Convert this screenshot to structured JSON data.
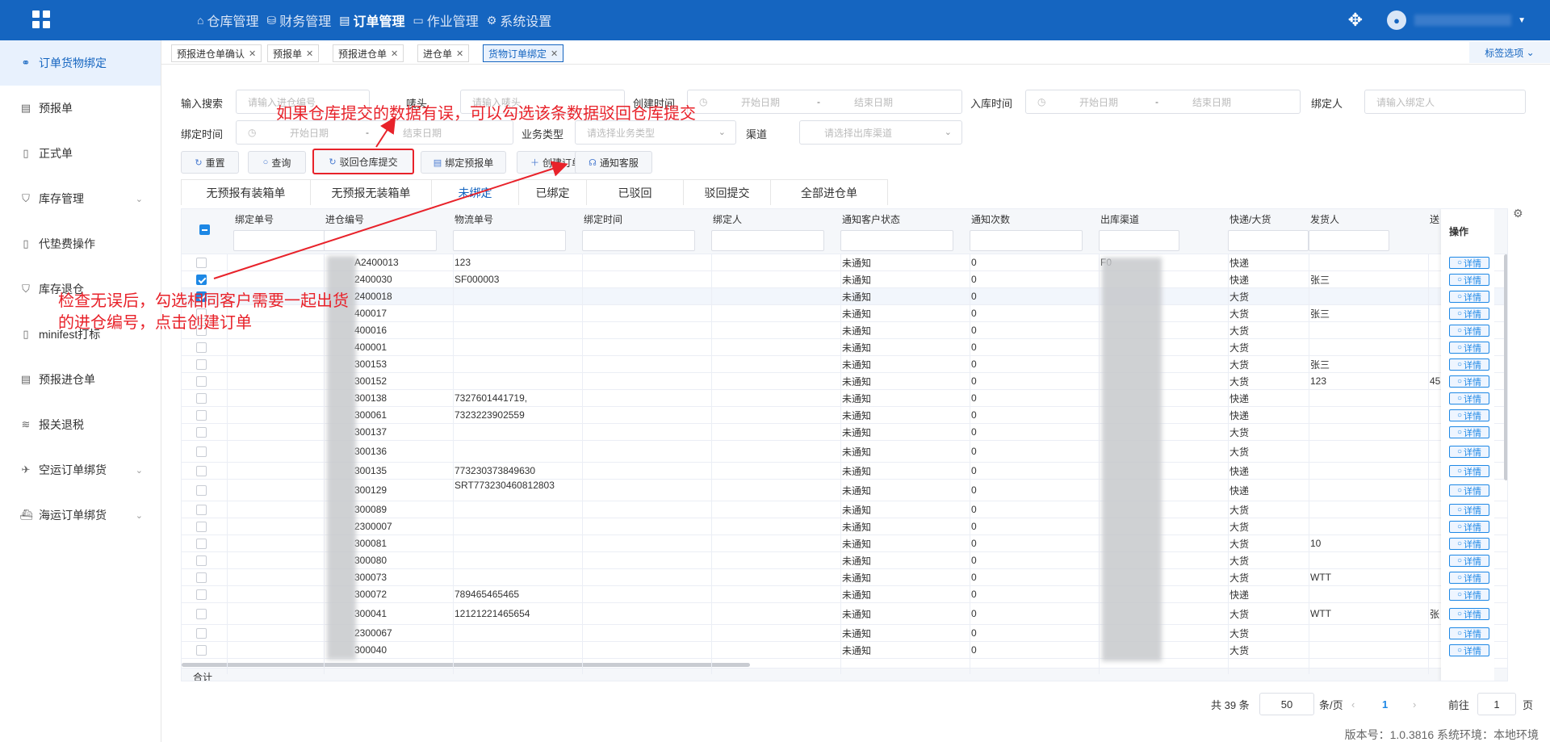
{
  "topbar": {
    "nav": [
      {
        "label": "仓库管理",
        "icon": "home-icon",
        "active": false
      },
      {
        "label": "财务管理",
        "icon": "database-icon",
        "active": false
      },
      {
        "label": "订单管理",
        "icon": "document-icon",
        "active": true
      },
      {
        "label": "作业管理",
        "icon": "folder-icon",
        "active": false
      },
      {
        "label": "系统设置",
        "icon": "gear-icon",
        "active": false
      }
    ]
  },
  "sidebar": {
    "items": [
      {
        "label": "订单货物绑定",
        "icon": "link-icon",
        "active": true,
        "expandable": false
      },
      {
        "label": "预报单",
        "icon": "list-icon",
        "active": false,
        "expandable": false
      },
      {
        "label": "正式单",
        "icon": "file-icon",
        "active": false,
        "expandable": false
      },
      {
        "label": "库存管理",
        "icon": "box-icon",
        "active": false,
        "expandable": true
      },
      {
        "label": "代垫费操作",
        "icon": "receipt-icon",
        "active": false,
        "expandable": false
      },
      {
        "label": "库存退仓",
        "icon": "return-icon",
        "active": false,
        "expandable": false
      },
      {
        "label": "minifest打标",
        "icon": "tag-icon",
        "active": false,
        "expandable": false
      },
      {
        "label": "预报进仓单",
        "icon": "file-text-icon",
        "active": false,
        "expandable": false
      },
      {
        "label": "报关退税",
        "icon": "stack-icon",
        "active": false,
        "expandable": false
      },
      {
        "label": "空运订单绑货",
        "icon": "plane-icon",
        "active": false,
        "expandable": true
      },
      {
        "label": "海运订单绑货",
        "icon": "ship-icon",
        "active": false,
        "expandable": true
      }
    ]
  },
  "tabs": {
    "items": [
      {
        "label": "预报进仓单确认",
        "active": false
      },
      {
        "label": "预报单",
        "active": false
      },
      {
        "label": "预报进仓单",
        "active": false
      },
      {
        "label": "进仓单",
        "active": false
      },
      {
        "label": "货物订单绑定",
        "active": true
      }
    ],
    "selector_label": "标签选项"
  },
  "filters": {
    "search_label": "输入搜索",
    "search_placeholder": "请输入进仓编号",
    "mark_label": "唛头",
    "mark_placeholder": "请输入唛头",
    "created_label": "创建时间",
    "inbound_label": "入库时间",
    "binder_label": "绑定人",
    "binder_placeholder": "请输入绑定人",
    "bind_time_label": "绑定时间",
    "business_label": "业务类型",
    "business_placeholder": "请选择业务类型",
    "channel_label": "渠道",
    "channel_placeholder": "请选择出库渠道",
    "start_placeholder": "开始日期",
    "end_placeholder": "结束日期",
    "date_sep": "-"
  },
  "toolbar": {
    "reset": "重置",
    "query": "查询",
    "reject": "驳回仓库提交",
    "bind_forecast": "绑定预报单",
    "create_order": "创建订单",
    "notify_service": "通知客服"
  },
  "status_tabs": [
    {
      "label": "无预报有装箱单",
      "active": false
    },
    {
      "label": "无预报无装箱单",
      "active": false
    },
    {
      "label": "未绑定",
      "active": true
    },
    {
      "label": "已绑定",
      "active": false
    },
    {
      "label": "已驳回",
      "active": false
    },
    {
      "label": "驳回提交",
      "active": false
    },
    {
      "label": "全部进仓单",
      "active": false
    }
  ],
  "table": {
    "columns": [
      "绑定单号",
      "进仓编号",
      "物流单号",
      "绑定时间",
      "绑定人",
      "通知客户状态",
      "通知次数",
      "出库渠道",
      "快递/大货",
      "发货人",
      "送"
    ],
    "op_header": "操作",
    "detail_label": "详情",
    "summary_label": "合计",
    "rows": [
      {
        "checked": false,
        "entry": "A2400013",
        "tracking": "123",
        "notify": "未通知",
        "count": "0",
        "channel": "F0",
        "type": "快递",
        "shipper": "",
        "extra": ""
      },
      {
        "checked": true,
        "entry": "2400030",
        "tracking": "SF000003",
        "notify": "未通知",
        "count": "0",
        "channel": "",
        "type": "快递",
        "shipper": "张三",
        "extra": ""
      },
      {
        "checked": true,
        "entry": "2400018",
        "tracking": "",
        "notify": "未通知",
        "count": "0",
        "channel": "",
        "type": "大货",
        "shipper": "",
        "extra": ""
      },
      {
        "checked": false,
        "entry": "400017",
        "tracking": "",
        "notify": "未通知",
        "count": "0",
        "channel": "",
        "type": "大货",
        "shipper": "张三",
        "extra": ""
      },
      {
        "checked": false,
        "entry": "400016",
        "tracking": "",
        "notify": "未通知",
        "count": "0",
        "channel": "",
        "type": "大货",
        "shipper": "",
        "extra": ""
      },
      {
        "checked": false,
        "entry": "400001",
        "tracking": "",
        "notify": "未通知",
        "count": "0",
        "channel": "",
        "type": "大货",
        "shipper": "",
        "extra": ""
      },
      {
        "checked": false,
        "entry": "300153",
        "tracking": "",
        "notify": "未通知",
        "count": "0",
        "channel": "",
        "type": "大货",
        "shipper": "张三",
        "extra": ""
      },
      {
        "checked": false,
        "entry": "300152",
        "tracking": "",
        "notify": "未通知",
        "count": "0",
        "channel": "",
        "type": "大货",
        "shipper": "123",
        "extra": "45"
      },
      {
        "checked": false,
        "entry": "300138",
        "tracking": "7327601441719,",
        "notify": "未通知",
        "count": "0",
        "channel": "",
        "type": "快递",
        "shipper": "",
        "extra": ""
      },
      {
        "checked": false,
        "entry": "300061",
        "tracking": "7323223902559",
        "notify": "未通知",
        "count": "0",
        "channel": "",
        "type": "快递",
        "shipper": "",
        "extra": ""
      },
      {
        "checked": false,
        "entry": "300137",
        "tracking": "",
        "notify": "未通知",
        "count": "0",
        "channel": "",
        "type": "大货",
        "shipper": "",
        "extra": ""
      },
      {
        "checked": false,
        "entry": "300136",
        "tracking": "",
        "notify": "未通知",
        "count": "0",
        "channel": "",
        "type": "大货",
        "shipper": "",
        "extra": ""
      },
      {
        "checked": false,
        "entry": "300135",
        "tracking": "773230373849630",
        "notify": "未通知",
        "count": "0",
        "channel": "",
        "type": "快递",
        "shipper": "",
        "extra": ""
      },
      {
        "checked": false,
        "entry": "300129",
        "tracking": "SRT773230460812803",
        "notify": "未通知",
        "count": "0",
        "channel": "",
        "type": "快递",
        "shipper": "",
        "extra": ""
      },
      {
        "checked": false,
        "entry": "300089",
        "tracking": "",
        "notify": "未通知",
        "count": "0",
        "channel": "",
        "type": "大货",
        "shipper": "",
        "extra": ""
      },
      {
        "checked": false,
        "entry": "2300007",
        "tracking": "",
        "notify": "未通知",
        "count": "0",
        "channel": "",
        "type": "大货",
        "shipper": "",
        "extra": ""
      },
      {
        "checked": false,
        "entry": "300081",
        "tracking": "",
        "notify": "未通知",
        "count": "0",
        "channel": "",
        "type": "大货",
        "shipper": "10",
        "extra": ""
      },
      {
        "checked": false,
        "entry": "300080",
        "tracking": "",
        "notify": "未通知",
        "count": "0",
        "channel": "",
        "type": "大货",
        "shipper": "",
        "extra": ""
      },
      {
        "checked": false,
        "entry": "300073",
        "tracking": "",
        "notify": "未通知",
        "count": "0",
        "channel": "",
        "type": "大货",
        "shipper": "WTT",
        "extra": ""
      },
      {
        "checked": false,
        "entry": "300072",
        "tracking": "789465465465",
        "notify": "未通知",
        "count": "0",
        "channel": "",
        "type": "快递",
        "shipper": "",
        "extra": ""
      },
      {
        "checked": false,
        "entry": "300041",
        "tracking": "12121221465654",
        "notify": "未通知",
        "count": "0",
        "channel": "",
        "type": "大货",
        "shipper": "WTT",
        "extra": "张"
      },
      {
        "checked": false,
        "entry": "2300067",
        "tracking": "",
        "notify": "未通知",
        "count": "0",
        "channel": "",
        "type": "大货",
        "shipper": "",
        "extra": ""
      },
      {
        "checked": false,
        "entry": "300040",
        "tracking": "",
        "notify": "未通知",
        "count": "0",
        "channel": "",
        "type": "大货",
        "shipper": "",
        "extra": ""
      }
    ]
  },
  "pagination": {
    "total": "共 39 条",
    "page_size": "50",
    "per_page": "条/页",
    "current": "1",
    "goto": "前往",
    "goto_value": "1",
    "page_unit": "页"
  },
  "footer": {
    "version": "版本号：1.0.3816 系统环境：本地环境"
  },
  "annotations": {
    "top": "如果仓库提交的数据有误，可以勾选该条数据驳回仓库提交",
    "left_line1": "检查无误后，勾选相同客户需要一起出货",
    "left_line2": "的进仓编号，点击创建订单"
  },
  "colors": {
    "primary": "#1565c0",
    "accent": "#1e88e5",
    "annotation": "#e8222a"
  }
}
